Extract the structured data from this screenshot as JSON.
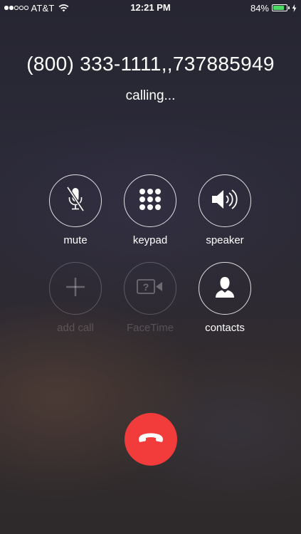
{
  "status_bar": {
    "signal_bars_on": 2,
    "signal_bars_total": 5,
    "carrier": "AT&T",
    "time": "12:21 PM",
    "battery_percent_text": "84%",
    "battery_level": 0.84,
    "battery_color": "#4cd964",
    "icons": [
      "wifi-icon",
      "charging-bolt-icon"
    ]
  },
  "call": {
    "number": "(800) 333-1111,,737885949",
    "status": "calling..."
  },
  "controls": [
    {
      "id": "mute",
      "label": "mute",
      "icon": "microphone-muted-icon",
      "enabled": true
    },
    {
      "id": "keypad",
      "label": "keypad",
      "icon": "keypad-icon",
      "enabled": true
    },
    {
      "id": "speaker",
      "label": "speaker",
      "icon": "speaker-icon",
      "enabled": true
    },
    {
      "id": "add_call",
      "label": "add call",
      "icon": "plus-icon",
      "enabled": false
    },
    {
      "id": "facetime",
      "label": "FaceTime",
      "icon": "facetime-icon",
      "enabled": false
    },
    {
      "id": "contacts",
      "label": "contacts",
      "icon": "contact-person-icon",
      "enabled": true
    }
  ],
  "end_call": {
    "icon": "end-call-phone-icon",
    "color": "#f23c3b"
  }
}
